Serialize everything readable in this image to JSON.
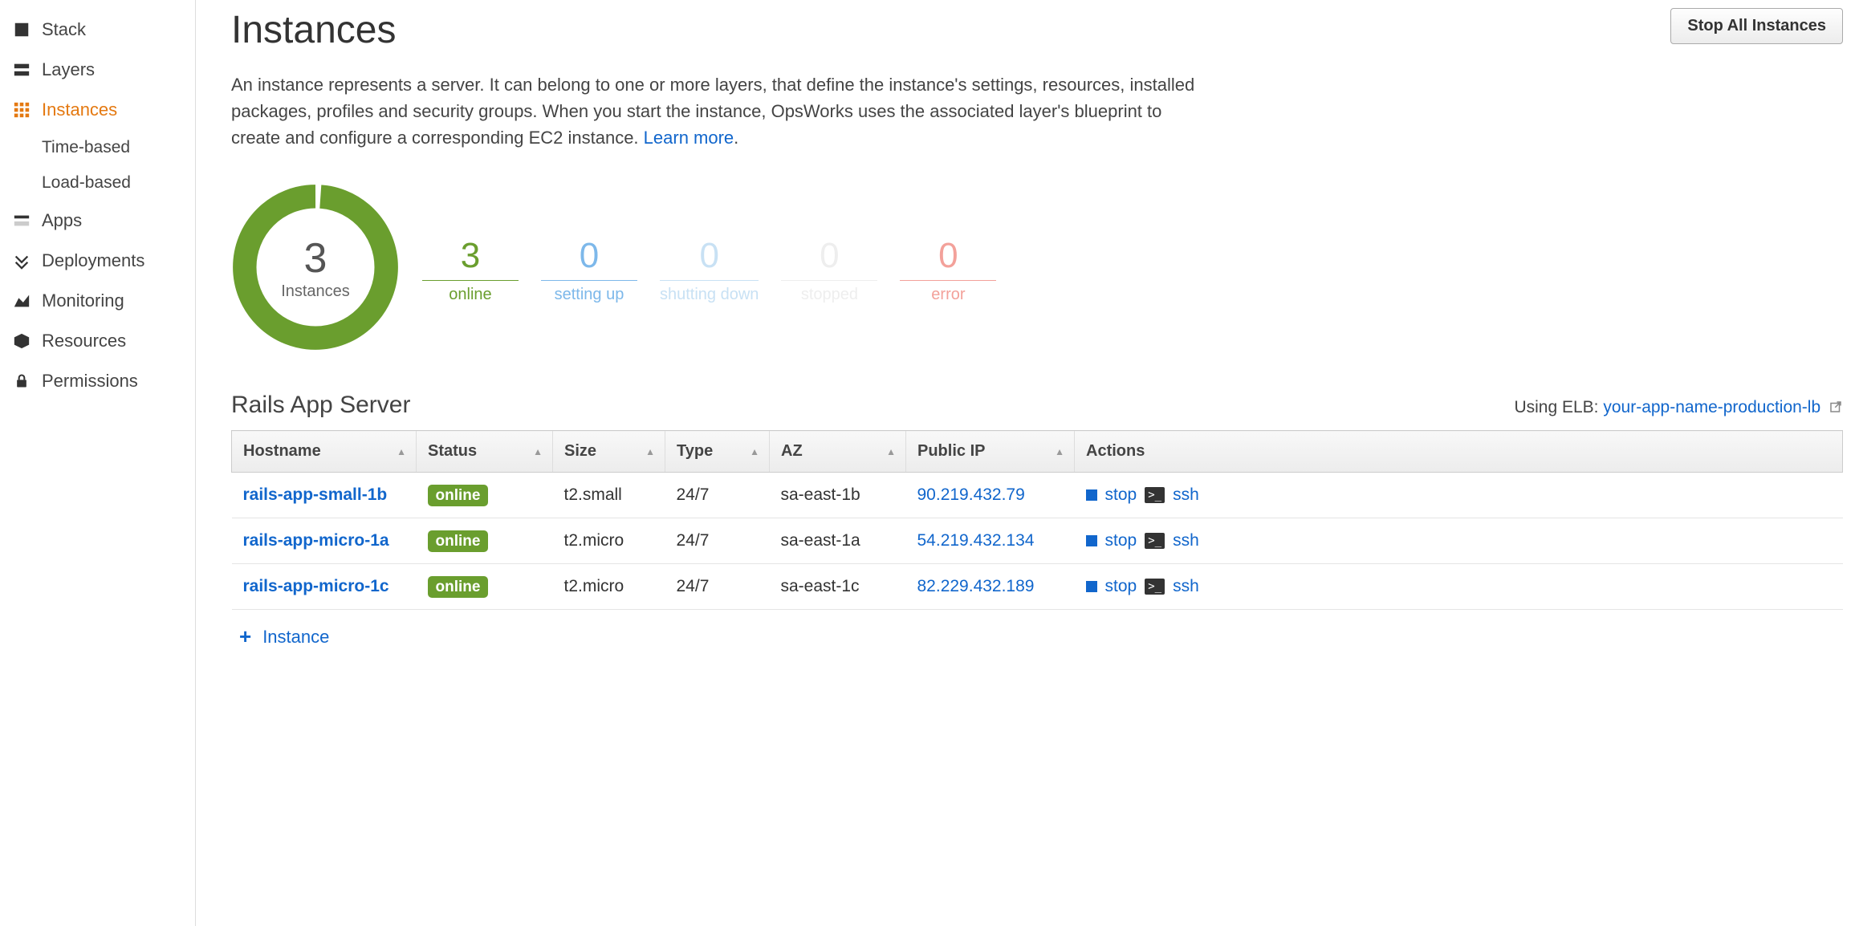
{
  "sidebar": {
    "items": [
      {
        "label": "Stack",
        "icon": "stack"
      },
      {
        "label": "Layers",
        "icon": "layers"
      },
      {
        "label": "Instances",
        "icon": "instances",
        "active": true,
        "sub": [
          {
            "label": "Time-based"
          },
          {
            "label": "Load-based"
          }
        ]
      },
      {
        "label": "Apps",
        "icon": "apps"
      },
      {
        "label": "Deployments",
        "icon": "deployments"
      },
      {
        "label": "Monitoring",
        "icon": "monitoring"
      },
      {
        "label": "Resources",
        "icon": "resources"
      },
      {
        "label": "Permissions",
        "icon": "permissions"
      }
    ]
  },
  "header": {
    "title": "Instances",
    "stop_all_label": "Stop All Instances"
  },
  "description": {
    "text": "An instance represents a server. It can belong to one or more layers, that define the instance's settings, resources, installed packages, profiles and security groups. When you start the instance, OpsWorks uses the associated layer's blueprint to create and configure a corresponding EC2 instance. ",
    "learn_more": "Learn more"
  },
  "summary": {
    "donut_value": "3",
    "donut_label": "Instances",
    "stats": [
      {
        "value": "3",
        "label": "online",
        "cls": "online"
      },
      {
        "value": "0",
        "label": "setting up",
        "cls": "setting"
      },
      {
        "value": "0",
        "label": "shutting down",
        "cls": "shutting"
      },
      {
        "value": "0",
        "label": "stopped",
        "cls": "stopped"
      },
      {
        "value": "0",
        "label": "error",
        "cls": "error"
      }
    ]
  },
  "layer": {
    "title": "Rails App Server",
    "elb_prefix": "Using ELB: ",
    "elb_name": "your-app-name-production-lb",
    "columns": [
      "Hostname",
      "Status",
      "Size",
      "Type",
      "AZ",
      "Public IP",
      "Actions"
    ],
    "rows": [
      {
        "hostname": "rails-app-small-1b",
        "status": "online",
        "size": "t2.small",
        "type": "24/7",
        "az": "sa-east-1b",
        "ip": "90.219.432.79"
      },
      {
        "hostname": "rails-app-micro-1a",
        "status": "online",
        "size": "t2.micro",
        "type": "24/7",
        "az": "sa-east-1a",
        "ip": "54.219.432.134"
      },
      {
        "hostname": "rails-app-micro-1c",
        "status": "online",
        "size": "t2.micro",
        "type": "24/7",
        "az": "sa-east-1c",
        "ip": "82.229.432.189"
      }
    ],
    "action_stop": "stop",
    "action_ssh": "ssh",
    "add_instance_label": "Instance"
  },
  "chart_data": {
    "type": "pie",
    "title": "Instances",
    "categories": [
      "online",
      "setting up",
      "shutting down",
      "stopped",
      "error"
    ],
    "values": [
      3,
      0,
      0,
      0,
      0
    ]
  }
}
